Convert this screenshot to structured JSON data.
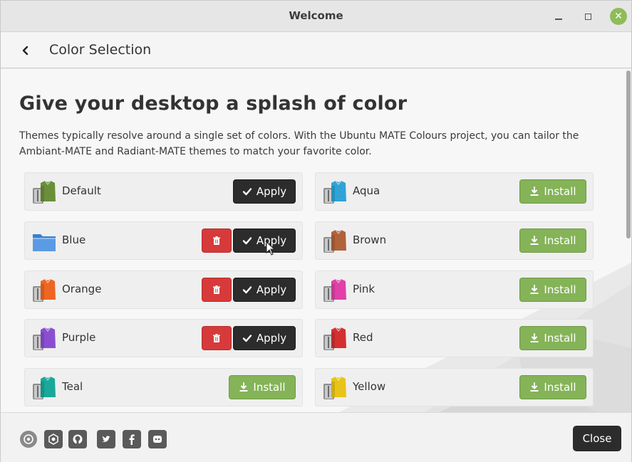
{
  "window": {
    "title": "Welcome"
  },
  "header": {
    "title": "Color Selection"
  },
  "main": {
    "headline": "Give your desktop a splash of color",
    "description": "Themes typically resolve around a single set of colors. With the Ubuntu MATE Colours project, you can tailor the Ambiant-MATE and Radiant-MATE themes to match your favorite color."
  },
  "labels": {
    "apply": "Apply",
    "install": "Install",
    "close": "Close"
  },
  "colors": {
    "accent_green": "#85b358",
    "dark_button": "#2c2c2c",
    "danger_red": "#d73a3a"
  },
  "themes": [
    {
      "name": "Default",
      "color": "#6a8f3a",
      "state": "installed",
      "removable": false,
      "icon": "shirt-icon"
    },
    {
      "name": "Aqua",
      "color": "#2fa3d6",
      "state": "available",
      "icon": "shirt-icon"
    },
    {
      "name": "Blue",
      "color": "#3b7fd1",
      "state": "installed",
      "removable": true,
      "icon": "folder-icon"
    },
    {
      "name": "Brown",
      "color": "#b0623a",
      "state": "available",
      "icon": "shirt-icon"
    },
    {
      "name": "Orange",
      "color": "#ee6622",
      "state": "installed",
      "removable": true,
      "icon": "shirt-icon"
    },
    {
      "name": "Pink",
      "color": "#e040a8",
      "state": "available",
      "icon": "shirt-icon"
    },
    {
      "name": "Purple",
      "color": "#8a4fd0",
      "state": "installed",
      "removable": true,
      "icon": "shirt-icon"
    },
    {
      "name": "Red",
      "color": "#d33030",
      "state": "available",
      "icon": "shirt-icon"
    },
    {
      "name": "Teal",
      "color": "#19a89a",
      "state": "available",
      "icon": "shirt-icon"
    },
    {
      "name": "Yellow",
      "color": "#e8c41a",
      "state": "available",
      "icon": "shirt-icon"
    }
  ],
  "footer": {
    "social_icons": [
      "ubuntu-mate-icon",
      "launchpad-icon",
      "github-icon",
      "twitter-icon",
      "facebook-icon",
      "discord-icon"
    ]
  }
}
